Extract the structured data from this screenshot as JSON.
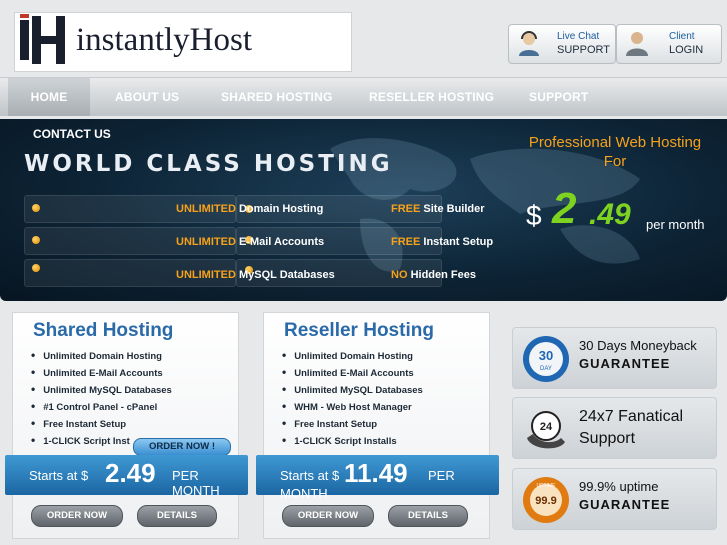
{
  "header": {
    "logo": {
      "mark": "iH",
      "text_left": "instantly",
      "text_right": "Host"
    },
    "livechat": {
      "line1": "Live  Chat",
      "line2": "SUPPORT",
      "icon": "support-agent-icon"
    },
    "login": {
      "line1": "Client",
      "line2": "LOGIN",
      "icon": "user-login-icon"
    }
  },
  "nav": {
    "items": [
      {
        "label": "HOME"
      },
      {
        "label": "ABOUT US"
      },
      {
        "label": "SHARED HOSTING"
      },
      {
        "label": "RESELLER HOSTING"
      },
      {
        "label": "SUPPORT"
      }
    ],
    "contact": "CONTACT US"
  },
  "banner": {
    "headline": "WORLD CLASS HOSTING",
    "features": [
      {
        "prefix": "UNLIMITED",
        "text": "Domain Hosting"
      },
      {
        "prefix": "UNLIMITED",
        "text": "E-Mail Accounts"
      },
      {
        "prefix": "UNLIMITED",
        "text": "MySQL Databases"
      }
    ],
    "extras": [
      {
        "prefix": "FREE",
        "text": "Site Builder"
      },
      {
        "prefix": "FREE",
        "text": "Instant Setup"
      },
      {
        "prefix": "NO",
        "text": "Hidden Fees"
      }
    ],
    "promo_line1": "Professional Web Hosting",
    "promo_line2": "For",
    "currency": "$",
    "price_int": "2",
    "price_dec": ".49",
    "per_month": "per month"
  },
  "plans": [
    {
      "title": "Shared Hosting",
      "features": [
        "Unlimited Domain Hosting",
        "Unlimited E-Mail Accounts",
        "Unlimited MySQL Databases",
        "#1 Control Panel - cPanel",
        "Free Instant Setup",
        "1-CLICK Script Inst"
      ],
      "order_tab": "ORDER NOW !",
      "starts_at": "Starts at $",
      "price": "2.49",
      "per": "PER MONTH",
      "order_label": "ORDER NOW",
      "details_label": "DETAILS"
    },
    {
      "title": "Reseller Hosting",
      "features": [
        "Unlimited Domain Hosting",
        "Unlimited E-Mail Accounts",
        "Unlimited MySQL Databases",
        "WHM - Web Host Manager",
        "Free Instant Setup",
        "1-CLICK Script Installs"
      ],
      "starts_at": "Starts at $",
      "price": "11.49",
      "per": "PER",
      "per2": "MONTH",
      "order_label": "ORDER NOW",
      "details_label": "DETAILS"
    }
  ],
  "guarantees": [
    {
      "line1": "30 Days Moneyback",
      "line2": "GUARANTEE",
      "badge_top": "30",
      "badge_sub": "DAY",
      "icon": "30-day-badge-icon"
    },
    {
      "line1": "24x7 Fanatical",
      "line2": "Support",
      "badge_top": "24",
      "icon": "headset-phone-icon"
    },
    {
      "line1": "99.9% uptime",
      "line2": "GUARANTEE",
      "badge_top": "99.9",
      "badge_sub": "UPTIME",
      "icon": "uptime-seal-icon"
    }
  ],
  "colors": {
    "accent_orange": "#f7a21b",
    "accent_blue": "#2a6aa8",
    "price_green": "#7ed321",
    "banner_dark": "#0d2436"
  }
}
